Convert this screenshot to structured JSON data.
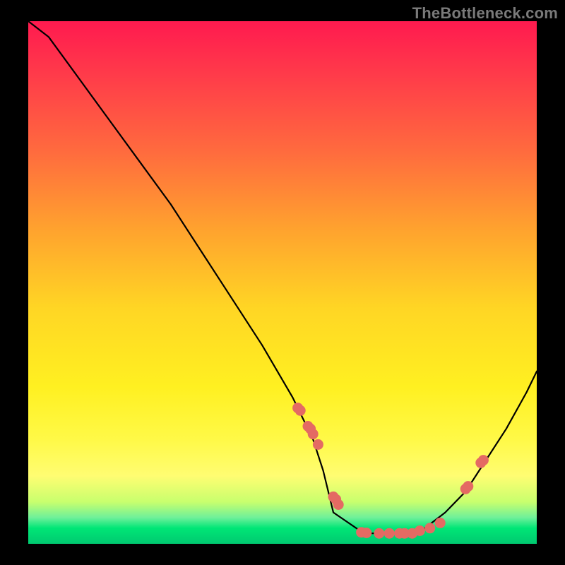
{
  "watermark": "TheBottleneck.com",
  "chart_data": {
    "type": "line",
    "title": "",
    "xlabel": "",
    "ylabel": "",
    "xlim": [
      0,
      1
    ],
    "ylim": [
      0,
      1
    ],
    "grid": false,
    "series": [
      {
        "name": "curve",
        "x": [
          0.0,
          0.04,
          0.1,
          0.16,
          0.22,
          0.28,
          0.34,
          0.4,
          0.46,
          0.52,
          0.56,
          0.58,
          0.6,
          0.66,
          0.72,
          0.78,
          0.82,
          0.86,
          0.9,
          0.94,
          0.98,
          1.0
        ],
        "y": [
          1.0,
          0.97,
          0.89,
          0.81,
          0.73,
          0.65,
          0.56,
          0.47,
          0.38,
          0.28,
          0.2,
          0.14,
          0.06,
          0.02,
          0.02,
          0.03,
          0.06,
          0.1,
          0.16,
          0.22,
          0.29,
          0.33
        ]
      }
    ],
    "markers": {
      "name": "points",
      "x": [
        0.53,
        0.535,
        0.55,
        0.555,
        0.56,
        0.57,
        0.6,
        0.605,
        0.61,
        0.655,
        0.665,
        0.69,
        0.71,
        0.73,
        0.74,
        0.755,
        0.77,
        0.79,
        0.81,
        0.86,
        0.865,
        0.89,
        0.895
      ],
      "y": [
        0.26,
        0.255,
        0.225,
        0.22,
        0.21,
        0.19,
        0.09,
        0.085,
        0.075,
        0.022,
        0.021,
        0.02,
        0.02,
        0.02,
        0.02,
        0.02,
        0.025,
        0.03,
        0.04,
        0.105,
        0.11,
        0.155,
        0.16
      ]
    },
    "gradient_stops": [
      {
        "pos": 0.0,
        "color": "#ff1a4f"
      },
      {
        "pos": 0.1,
        "color": "#ff3a4a"
      },
      {
        "pos": 0.25,
        "color": "#ff6b3e"
      },
      {
        "pos": 0.4,
        "color": "#ffa32e"
      },
      {
        "pos": 0.55,
        "color": "#ffd624"
      },
      {
        "pos": 0.7,
        "color": "#fff021"
      },
      {
        "pos": 0.8,
        "color": "#fff947"
      },
      {
        "pos": 0.87,
        "color": "#fffd72"
      },
      {
        "pos": 0.92,
        "color": "#c8ff6e"
      },
      {
        "pos": 0.95,
        "color": "#6ef09a"
      },
      {
        "pos": 0.97,
        "color": "#00e676"
      },
      {
        "pos": 1.0,
        "color": "#00c970"
      }
    ]
  }
}
